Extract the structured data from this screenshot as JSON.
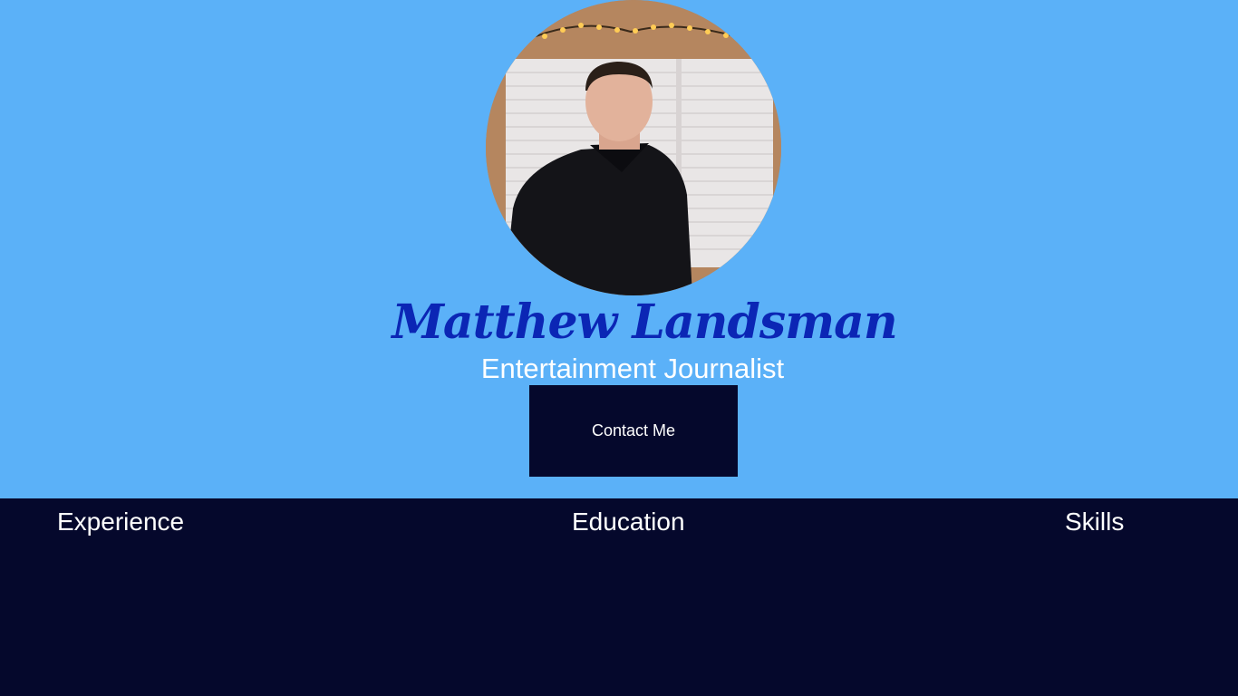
{
  "profile": {
    "name": "Matthew Landsman",
    "title": "Entertainment Journalist",
    "photo_alt": "Portrait photo"
  },
  "actions": {
    "contact_label": "Contact Me"
  },
  "sections": {
    "experience": "Experience",
    "education": "Education",
    "skills": "Skills"
  },
  "colors": {
    "hero_background": "#5bb1f8",
    "dark_navy": "#05082c",
    "name_blue": "#0b26b5",
    "text_white": "#ffffff"
  }
}
